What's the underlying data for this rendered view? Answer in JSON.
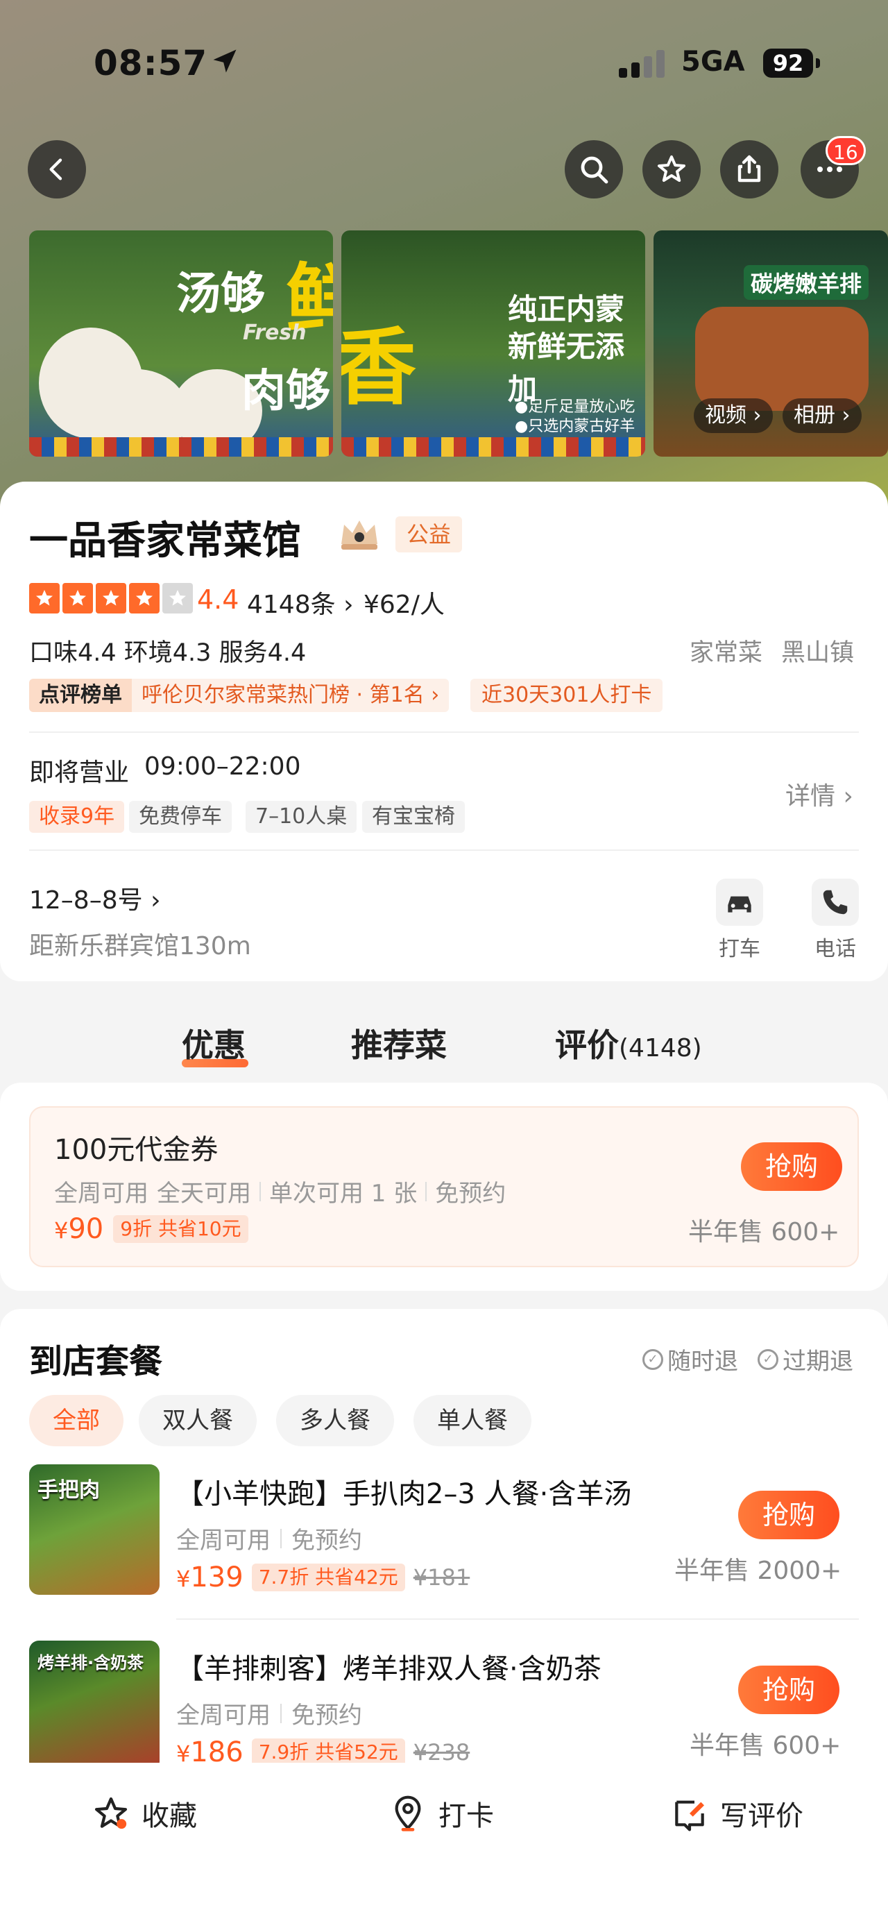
{
  "status_bar": {
    "time": "08:57",
    "network": "5GA",
    "battery": "92"
  },
  "top_nav": {
    "notification_count": "16"
  },
  "banners": [
    {
      "line1": "汤够",
      "big1": "鲜",
      "line2": "肉够",
      "big2": "香",
      "sub": "Fresh"
    },
    {
      "line1": "纯正内蒙",
      "line2": "新鲜无添加",
      "bullet1": "●足斤足量放心吃",
      "bullet2": "●只选内蒙古好羊肉"
    },
    {
      "title": "碳烤嫩羊排",
      "video": "视频",
      "album": "相册"
    }
  ],
  "shop": {
    "name": "一品香家常菜馆",
    "public_tag": "公益",
    "rating": "4.4",
    "review_count": "4148条",
    "avg_price": "¥62/人",
    "sub_scores": "口味4.4  环境4.3  服务4.4",
    "category": "家常菜",
    "area": "黑山镇",
    "rank_label": "点评榜单",
    "rank_text": "呼伦贝尔家常菜热门榜 · 第1名",
    "checkin": "近30天301人打卡",
    "open_status": "即将营业",
    "hours": "09:00–22:00",
    "details": "详情",
    "chips": [
      "收录9年",
      "免费停车",
      "7–10人桌",
      "有宝宝椅"
    ],
    "address": "12–8–8号",
    "distance": "距新乐群宾馆130m",
    "taxi": "打车",
    "phone": "电话"
  },
  "tabs": [
    {
      "label": "优惠"
    },
    {
      "label": "推荐菜"
    },
    {
      "label": "评价",
      "count": "(4148)"
    }
  ],
  "coupon": {
    "title": "100元代金券",
    "conditions": [
      "全周可用",
      "全天可用",
      "单次可用 1 张",
      "免预约"
    ],
    "currency": "¥",
    "price": "90",
    "discount": "9折  共省10元",
    "buy": "抢购",
    "sold": "半年售 600+"
  },
  "packages": {
    "title": "到店套餐",
    "refund_any": "随时退",
    "refund_expired": "过期退",
    "filters": [
      "全部",
      "双人餐",
      "多人餐",
      "单人餐"
    ],
    "items": [
      {
        "thumb_label": "手把肉",
        "name": "【小羊快跑】手扒肉2–3 人餐·含羊汤",
        "use": "全周可用",
        "reserve": "免预约",
        "currency": "¥",
        "price": "139",
        "discount": "7.7折  共省42元",
        "original": "¥181",
        "buy": "抢购",
        "sold": "半年售 2000+"
      },
      {
        "thumb_label": "烤羊排·含奶茶",
        "name": "【羊排刺客】烤羊排双人餐·含奶茶",
        "use": "全周可用",
        "reserve": "免预约",
        "currency": "¥",
        "price": "186",
        "discount": "7.9折  共省52元",
        "original": "¥238",
        "buy": "抢购",
        "sold": "半年售 600+"
      }
    ]
  },
  "bottom_bar": {
    "favorite": "收藏",
    "checkin": "打卡",
    "review": "写评价"
  },
  "colors": {
    "accent": "#ff5a1f",
    "star": "#ff6a2a"
  }
}
